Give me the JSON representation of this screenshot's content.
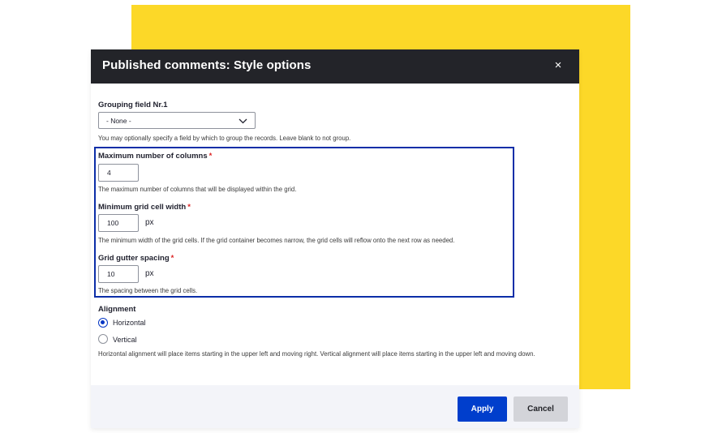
{
  "dialog": {
    "title": "Published comments: Style options",
    "close_label": "×"
  },
  "grouping": {
    "label": "Grouping field Nr.1",
    "selected": "- None -",
    "description": "You may optionally specify a field by which to group the records. Leave blank to not group."
  },
  "columns": {
    "label": "Maximum number of columns",
    "required_mark": "*",
    "value": "4",
    "description": "The maximum number of columns that will be displayed within the grid."
  },
  "cell_width": {
    "label": "Minimum grid cell width",
    "required_mark": "*",
    "value": "100",
    "unit": "px",
    "description": "The minimum width of the grid cells. If the grid container becomes narrow, the grid cells will reflow onto the next row as needed."
  },
  "gutter": {
    "label": "Grid gutter spacing",
    "required_mark": "*",
    "value": "10",
    "unit": "px",
    "description": "The spacing between the grid cells."
  },
  "alignment": {
    "label": "Alignment",
    "options": [
      {
        "label": "Horizontal",
        "checked": true
      },
      {
        "label": "Vertical",
        "checked": false
      }
    ],
    "description": "Horizontal alignment will place items starting in the upper left and moving right. Vertical alignment will place items starting in the upper left and moving down."
  },
  "footer": {
    "apply_label": "Apply",
    "cancel_label": "Cancel"
  },
  "colors": {
    "backdrop_accent": "#fcd828",
    "titlebar": "#232429",
    "primary_button": "#003ecc",
    "highlight_border": "#0c2ea8",
    "required": "#dc2323"
  },
  "icons": {
    "close": "close-icon",
    "select_arrow": "chevron-down-icon"
  }
}
